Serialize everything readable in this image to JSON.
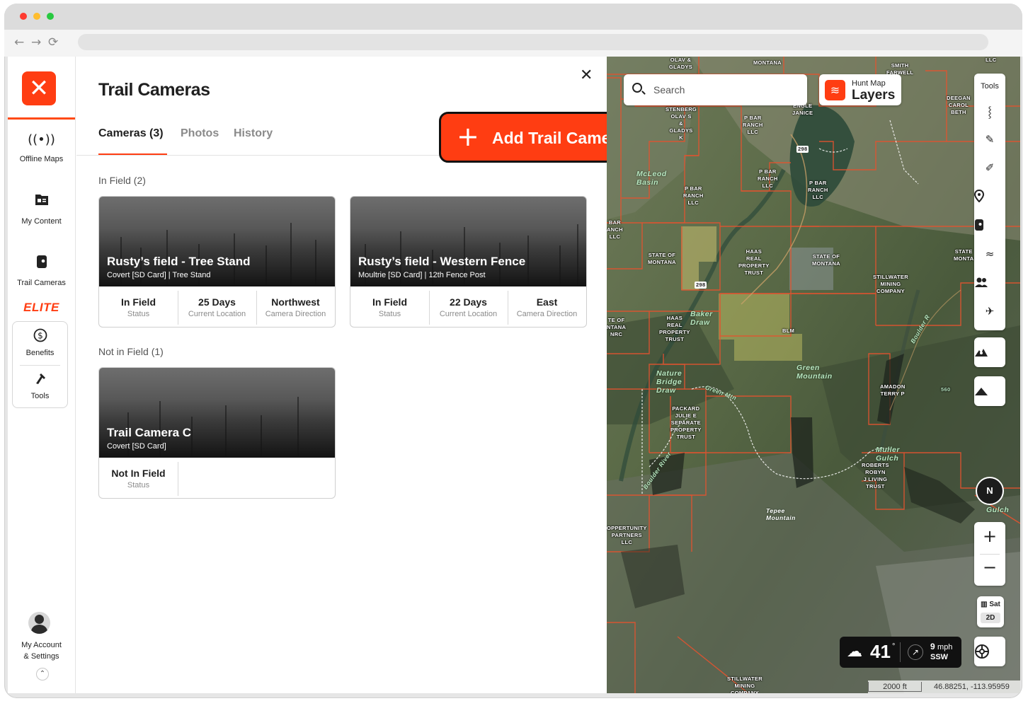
{
  "sidebar": {
    "logo_glyph": "✕",
    "items": [
      {
        "label": "Offline Maps",
        "icon": "offline-maps-icon"
      },
      {
        "label": "My Content",
        "icon": "my-content-icon"
      },
      {
        "label": "Trail Cameras",
        "icon": "trail-camera-icon"
      }
    ],
    "elite_label": "ELITE",
    "elite_items": [
      {
        "label": "Benefits",
        "icon": "dollar-icon"
      },
      {
        "label": "Tools",
        "icon": "tools-icon"
      }
    ],
    "account_label_1": "My Account",
    "account_label_2": "& Settings"
  },
  "panel": {
    "title": "Trail Cameras",
    "tabs": [
      {
        "label": "Cameras (3)",
        "active": true
      },
      {
        "label": "Photos",
        "active": false
      },
      {
        "label": "History",
        "active": false
      }
    ],
    "add_button_label": "Add Trail Camera",
    "sections": [
      {
        "label": "In Field (2)",
        "cards": [
          {
            "title": "Rusty’s field - Tree Stand",
            "subtitle": "Covert [SD Card] | Tree Stand",
            "stats": [
              {
                "value": "In Field",
                "label": "Status"
              },
              {
                "value": "25 Days",
                "label": "Current Location"
              },
              {
                "value": "Northwest",
                "label": "Camera Direction"
              }
            ]
          },
          {
            "title": "Rusty’s field - Western Fence",
            "subtitle": "Moultrie [SD Card] | 12th Fence Post",
            "stats": [
              {
                "value": "In Field",
                "label": "Status"
              },
              {
                "value": "22 Days",
                "label": "Current Location"
              },
              {
                "value": "East",
                "label": "Camera Direction"
              }
            ]
          }
        ]
      },
      {
        "label": "Not in Field (1)",
        "cards": [
          {
            "title": "Trail Camera C",
            "subtitle": "Covert [SD Card]",
            "stats": [
              {
                "value": "Not In Field",
                "label": "Status"
              }
            ]
          }
        ]
      }
    ]
  },
  "map": {
    "search_placeholder": "Search",
    "layers_small": "Hunt Map",
    "layers_big": "Layers",
    "tools_title": "Tools",
    "compass_label": "N",
    "sat_label": "Sat",
    "mode_label": "2D",
    "weather": {
      "temp": "41",
      "deg": "°",
      "speed": "9",
      "unit": "mph",
      "dir": "SSW"
    },
    "scale": "2000 ft",
    "coordinates": "46.88251, -113.95959",
    "labels": [
      "OLAV &\nGLADYS",
      "MONTANA",
      "SMITH\nFARWELL",
      "LLC",
      "DEEGAN\nCAROL\nBETH",
      "ENGLE\nJANICE",
      "STENBERG\nOLAV S\n&\nGLADYS\nK",
      "P BAR\nRANCH\nLLC",
      "P BAR\nRANCH\nLLC",
      "P BAR\nRANCH\nLLC",
      "P BAR\nRANCH\nLLC",
      "BAR\nANCH\nLLC",
      "STATE OF\nMONTANA",
      "HAAS\nREAL\nPROPERTY\nTRUST",
      "STATE OF\nMONTANA",
      "STATE\nMONTA",
      "STILLWATER\nMINING\nCOMPANY",
      "TE OF\nNTANA\nNRC",
      "HAAS\nREAL\nPROPERTY\nTRUST",
      "BLM",
      "AMADON\nTERRY P",
      "560",
      "PACKARD\nJULIE E\nSEPARATE\nPROPERTY\nTRUST",
      "ROBERTS\nROBYN\nJ LIVING\nTRUST",
      "OPPERTUNITY\nPARTNERS\nLLC",
      "STILLWATER\nMINING\nCOMPANY",
      "298",
      "298"
    ],
    "names": [
      "McLeod\nBasin",
      "Baker\nDraw",
      "Green\nMountain",
      "Nature\nBridge\nDraw",
      "Green Mtn",
      "Boulder River",
      "Tepee\nMountain",
      "Muller\nGulch",
      "Gulch",
      "Boulder R"
    ]
  }
}
